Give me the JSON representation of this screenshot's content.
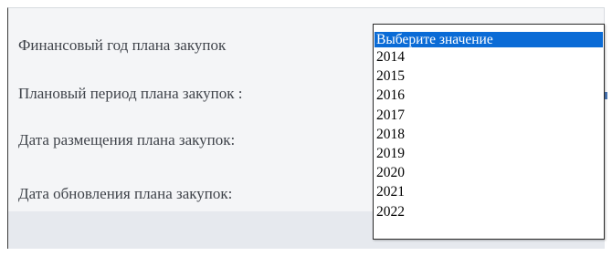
{
  "form": {
    "fields": [
      {
        "label": "Финансовый год плана закупок"
      },
      {
        "label": "Плановый период плана закупок :"
      },
      {
        "label": "Дата размещения плана закупок:"
      },
      {
        "label": "Дата обновления плана закупок:"
      }
    ]
  },
  "dropdown": {
    "selected_index": 0,
    "options": [
      "Выберите значение",
      "2014",
      "2015",
      "2016",
      "2017",
      "2018",
      "2019",
      "2020",
      "2021",
      "2022"
    ]
  },
  "colors": {
    "highlight": "#0a6bd6",
    "label_text": "#3f434a",
    "panel_bg": "#f4f5f7",
    "footer_bg": "#e6e9ee"
  }
}
